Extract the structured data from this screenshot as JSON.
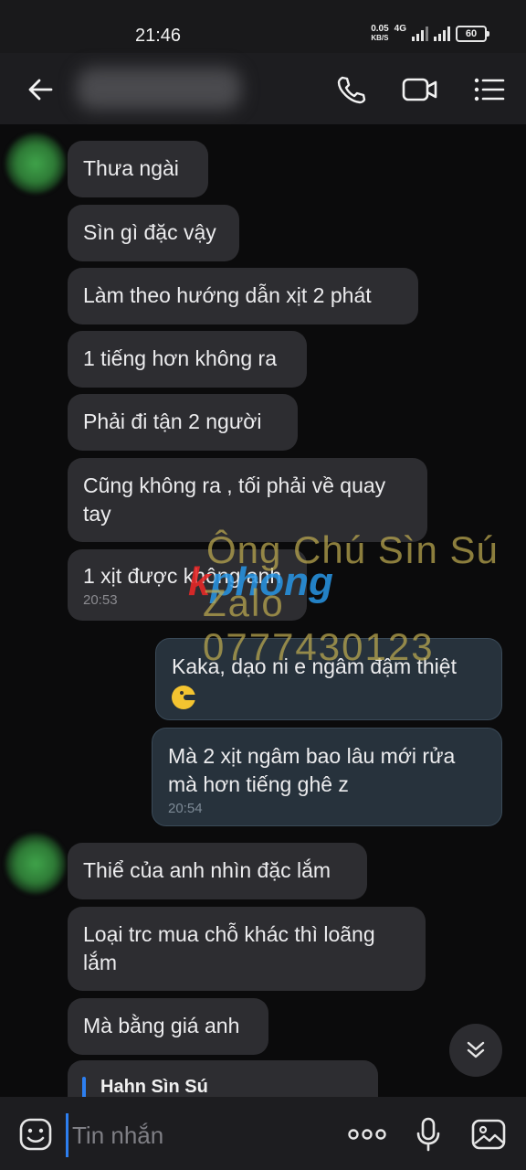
{
  "status_bar": {
    "time": "21:46",
    "speed_value": "0.05",
    "speed_unit": "KB/S",
    "network": "4G",
    "battery": "60"
  },
  "header": {
    "contact_name": "",
    "icons": [
      "back-arrow-icon",
      "phone-icon",
      "video-call-icon",
      "menu-list-icon"
    ]
  },
  "messages": [
    {
      "side": "in",
      "text": "Thưa ngài"
    },
    {
      "side": "in",
      "text": "Sìn gì đặc vậy"
    },
    {
      "side": "in",
      "text": "Làm theo hướng dẫn xịt 2 phát"
    },
    {
      "side": "in",
      "text": "1 tiếng hơn không ra"
    },
    {
      "side": "in",
      "text": "Phải đi tận 2 người"
    },
    {
      "side": "in",
      "text": "Cũng không ra , tối phải về quay tay"
    },
    {
      "side": "in",
      "text": "1 xịt được không anh",
      "time": "20:53"
    },
    {
      "side": "out",
      "text": "Kaka, dạo ni e ngâm đậm thiệt"
    },
    {
      "side": "out",
      "text": "Mà 2 xịt ngâm bao lâu mới rửa mà hơn tiếng ghê z",
      "time": "20:54"
    },
    {
      "side": "in",
      "text": "Thiể của anh nhìn đặc lắm"
    },
    {
      "side": "in",
      "text": "Loại trc mua chỗ khác thì loãng lắm"
    },
    {
      "side": "in",
      "text": "Mà bằng giá anh"
    }
  ],
  "quote": {
    "name": "Hahn Sìn Sú"
  },
  "watermark": {
    "line1": "Ông Chú Sìn Sú",
    "line2": "Zalo 0777430123",
    "logo_r": "k",
    "logo_rest": "phong"
  },
  "input": {
    "placeholder": "Tin nhắn"
  },
  "colors": {
    "accent": "#2d7ff0",
    "incoming_bubble": "#2d2d31",
    "outgoing_bubble": "#27323c"
  }
}
